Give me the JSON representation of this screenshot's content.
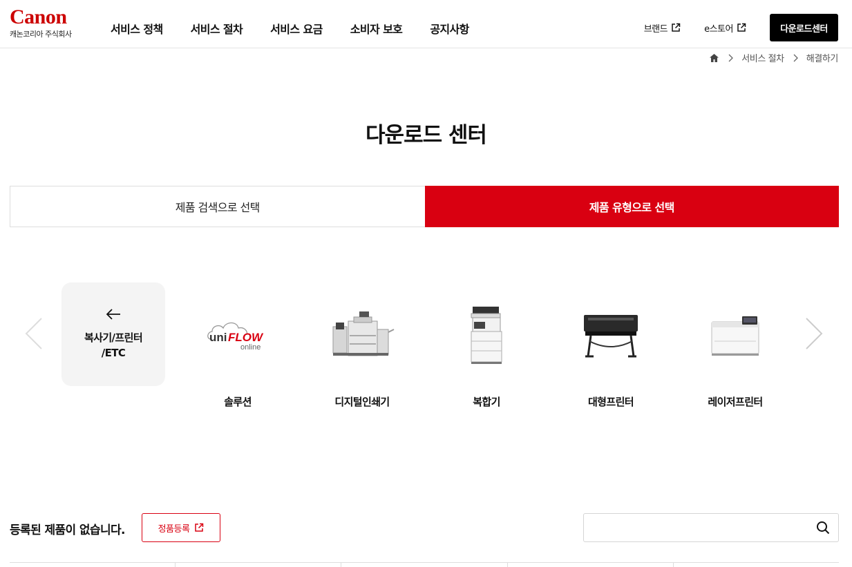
{
  "header": {
    "logo_text": "Canon",
    "logo_sub": "캐논코리아 주식회사",
    "nav": [
      "서비스 정책",
      "서비스 절차",
      "서비스 요금",
      "소비자 보호",
      "공지사항"
    ],
    "util_links": [
      "브랜드",
      "e스토어"
    ],
    "download_button": "다운로드센터"
  },
  "breadcrumb": [
    "서비스 절차",
    "해결하기"
  ],
  "page_title": "다운로드 센터",
  "tabs": {
    "search": "제품 검색으로 선택",
    "type": "제품 유형으로 선택",
    "active": "type"
  },
  "carousel": {
    "back_label": "복사기/프린터\n/ETC",
    "products": [
      {
        "label": "솔루션",
        "icon": "uniflow-online-logo"
      },
      {
        "label": "디지털인쇄기",
        "icon": "production-printer-image"
      },
      {
        "label": "복합기",
        "icon": "multifunction-printer-image"
      },
      {
        "label": "대형프린터",
        "icon": "large-format-printer-image"
      },
      {
        "label": "레이저프린터",
        "icon": "laser-printer-image"
      }
    ]
  },
  "registered": {
    "empty_text": "등록된 제품이 없습니다.",
    "register_button": "정품등록"
  },
  "search": {
    "placeholder": "",
    "value": ""
  },
  "colors": {
    "brand": "#cc0000",
    "accent": "#d90011",
    "black": "#000000"
  },
  "uniflow": {
    "uni": "uni",
    "flow": "FLOW",
    "online": "online"
  }
}
